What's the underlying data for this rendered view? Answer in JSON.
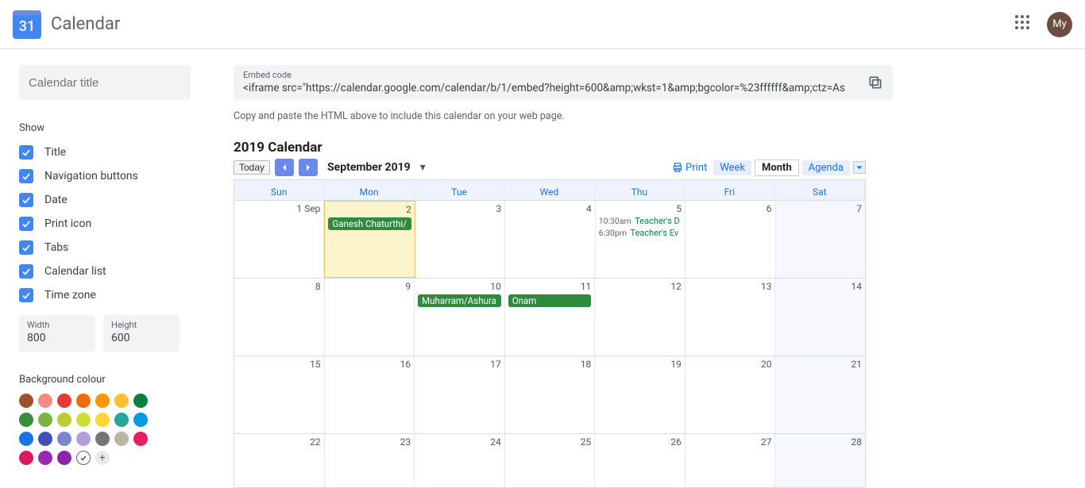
{
  "header": {
    "logo_day": "31",
    "app_name": "Calendar",
    "avatar_text": "My"
  },
  "sidebar": {
    "title_placeholder": "Calendar title",
    "show_label": "Show",
    "checks": {
      "title": "Title",
      "nav": "Navigation buttons",
      "date": "Date",
      "print": "Print icon",
      "tabs": "Tabs",
      "callist": "Calendar list",
      "tz": "Time zone"
    },
    "width_label": "Width",
    "width_value": "800",
    "height_label": "Height",
    "height_value": "600",
    "bg_label": "Background colour",
    "swatch_colors": [
      "#a0522d",
      "#f28b82",
      "#e53935",
      "#ef6c00",
      "#ff9800",
      "#fbc02d",
      "#0b8043",
      "#388e3c",
      "#7cb342",
      "#c0ca33",
      "#cddc39",
      "#fdd835",
      "#26a69a",
      "#039be5",
      "#1a73e8",
      "#3f51b5",
      "#7986cb",
      "#b39ddb",
      "#757575",
      "#bdb5a4",
      "#e91e63",
      "#d81b60",
      "#9c27b0",
      "#8e24aa"
    ]
  },
  "embed": {
    "label": "Embed code",
    "code": "<iframe src=\"https://calendar.google.com/calendar/b/1/embed?height=600&amp;wkst=1&amp;bgcolor=%23ffffff&amp;ctz=As",
    "help": "Copy and paste the HTML above to include this calendar on your web page."
  },
  "calendar": {
    "title": "2019 Calendar",
    "today_btn": "Today",
    "month_label": "September 2019",
    "print_label": "Print",
    "tabs": {
      "week": "Week",
      "month": "Month",
      "agenda": "Agenda"
    },
    "day_headers": [
      "Sun",
      "Mon",
      "Tue",
      "Wed",
      "Thu",
      "Fri",
      "Sat"
    ],
    "weeks": [
      {
        "days": [
          {
            "num": "1 Sep"
          },
          {
            "num": "2",
            "today": true,
            "events": [
              {
                "type": "chip",
                "text": "Ganesh Chaturthi/"
              }
            ]
          },
          {
            "num": "3"
          },
          {
            "num": "4"
          },
          {
            "num": "5",
            "events": [
              {
                "type": "time",
                "time": "10:30am",
                "text": "Teacher's D"
              },
              {
                "type": "time",
                "time": "6:30pm",
                "text": "Teacher's Ev"
              }
            ]
          },
          {
            "num": "6"
          },
          {
            "num": "7"
          }
        ]
      },
      {
        "days": [
          {
            "num": "8"
          },
          {
            "num": "9"
          },
          {
            "num": "10",
            "events": [
              {
                "type": "chip",
                "text": "Muharram/Ashura"
              }
            ]
          },
          {
            "num": "11",
            "events": [
              {
                "type": "chip",
                "text": "Onam"
              }
            ]
          },
          {
            "num": "12"
          },
          {
            "num": "13"
          },
          {
            "num": "14"
          }
        ]
      },
      {
        "days": [
          {
            "num": "15"
          },
          {
            "num": "16"
          },
          {
            "num": "17"
          },
          {
            "num": "18"
          },
          {
            "num": "19"
          },
          {
            "num": "20"
          },
          {
            "num": "21"
          }
        ]
      },
      {
        "days": [
          {
            "num": "22"
          },
          {
            "num": "23"
          },
          {
            "num": "24"
          },
          {
            "num": "25"
          },
          {
            "num": "26"
          },
          {
            "num": "27"
          },
          {
            "num": "28"
          }
        ],
        "short": true
      }
    ]
  }
}
